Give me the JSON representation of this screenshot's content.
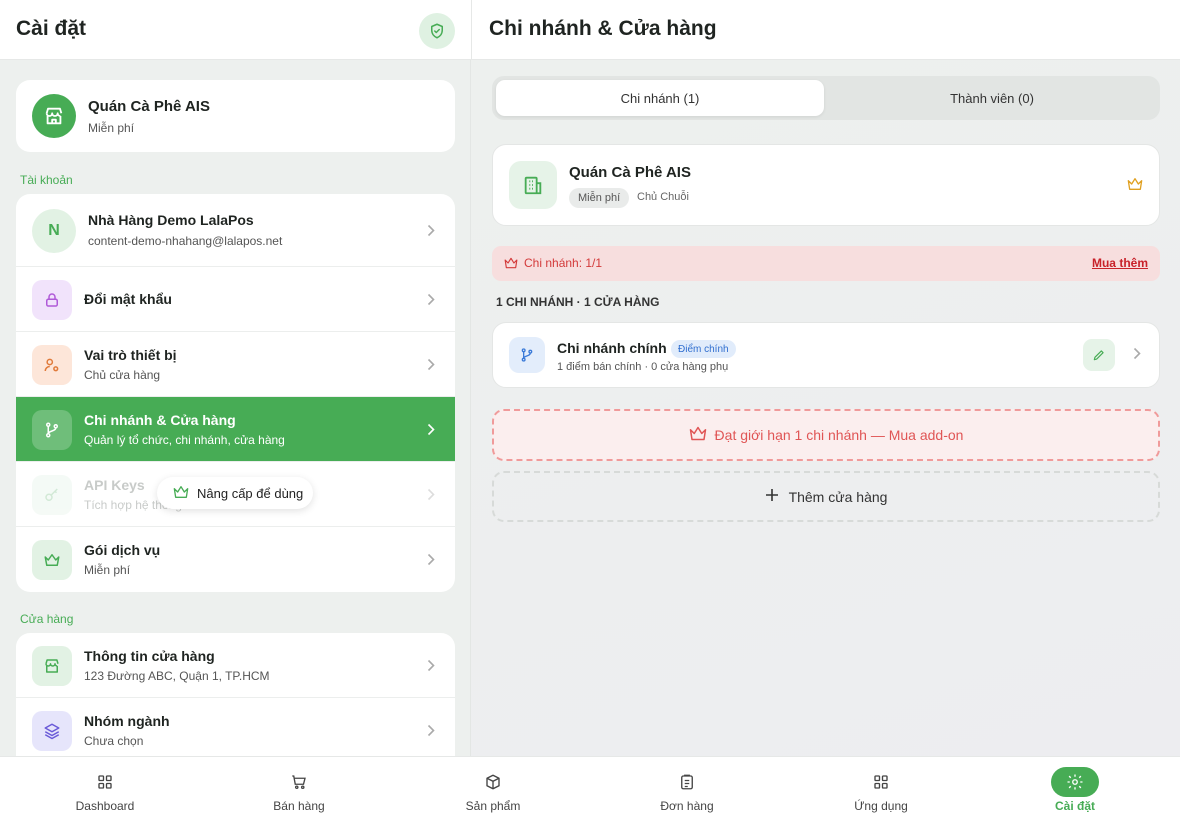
{
  "header": {
    "left_title": "Cài đặt",
    "right_title": "Chi nhánh & Cửa hàng"
  },
  "store": {
    "name": "Quán Cà Phê AIS",
    "plan": "Miễn phí"
  },
  "sections": {
    "account": "Tài khoản",
    "store": "Cửa hàng"
  },
  "account_items": [
    {
      "title": "Nhà Hàng Demo LalaPos",
      "subtitle": "content-demo-nhahang@lalapos.net",
      "avatar": "N"
    },
    {
      "title": "Đổi mật khẩu",
      "subtitle": ""
    },
    {
      "title": "Vai trò thiết bị",
      "subtitle": "Chủ cửa hàng"
    },
    {
      "title": "Chi nhánh & Cửa hàng",
      "subtitle": "Quản lý tổ chức, chi nhánh, cửa hàng"
    },
    {
      "title": "API Keys",
      "subtitle": "Tích hợp hệ thống"
    },
    {
      "title": "Gói dịch vụ",
      "subtitle": "Miễn phí"
    }
  ],
  "upgrade_pill": "Nâng cấp để dùng",
  "store_items": [
    {
      "title": "Thông tin cửa hàng",
      "subtitle": "123 Đường ABC, Quận 1, TP.HCM"
    },
    {
      "title": "Nhóm ngành",
      "subtitle": "Chưa chọn"
    }
  ],
  "tabs": [
    {
      "label": "Chi nhánh (1)",
      "active": true
    },
    {
      "label": "Thành viên (0)",
      "active": false
    }
  ],
  "chain": {
    "name": "Quán Cà Phê AIS",
    "badge": "Miễn phí",
    "role": "Chủ Chuỗi"
  },
  "limit": {
    "text": "Chi nhánh: 1/1",
    "buy": "Mua thêm"
  },
  "count_label": "1 CHI NHÁNH · 1 CỬA HÀNG",
  "branch": {
    "name": "Chi nhánh chính",
    "badge": "Điểm chính",
    "sub": "1 điểm bán chính · 0 cửa hàng phụ"
  },
  "addon_text": "Đạt giới hạn 1 chi nhánh — Mua add-on",
  "add_store_text": "Thêm cửa hàng",
  "nav": [
    {
      "label": "Dashboard",
      "icon": "grid-icon"
    },
    {
      "label": "Bán hàng",
      "icon": "cart-icon"
    },
    {
      "label": "Sản phẩm",
      "icon": "box-icon"
    },
    {
      "label": "Đơn hàng",
      "icon": "clipboard-icon"
    },
    {
      "label": "Ứng dụng",
      "icon": "apps-icon"
    },
    {
      "label": "Cài đặt",
      "icon": "gear-icon",
      "active": true
    }
  ],
  "colors": {
    "primary": "#47ac55",
    "danger": "#d33a3a",
    "crown": "#e0a020"
  }
}
